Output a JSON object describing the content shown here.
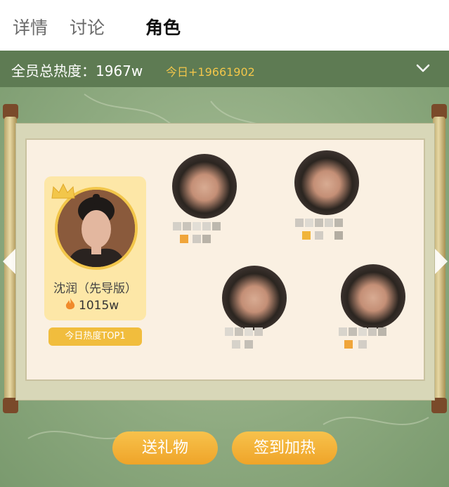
{
  "tabs": [
    {
      "label": "详情",
      "active": false
    },
    {
      "label": "讨论",
      "active": false
    },
    {
      "label": "角色",
      "active": true
    }
  ],
  "heat": {
    "label": "全员总热度：",
    "total": "1967w",
    "today": "今日+19661902"
  },
  "top_role": {
    "name": "沈润（先导版）",
    "heat": "1015w",
    "badge": "今日热度TOP1"
  },
  "buttons": {
    "gift": "送礼物",
    "checkin": "签到加热"
  },
  "colors": {
    "accent": "#f1bd3d",
    "heat_today": "#f2c64a",
    "panel_bg": "#faf0e2",
    "header_bar": "#5e7b53"
  },
  "icons": {
    "expand": "chevron-down-icon",
    "left": "chevron-left-icon",
    "right": "chevron-right-icon",
    "fire": "fire-icon",
    "crown": "crown-icon"
  }
}
